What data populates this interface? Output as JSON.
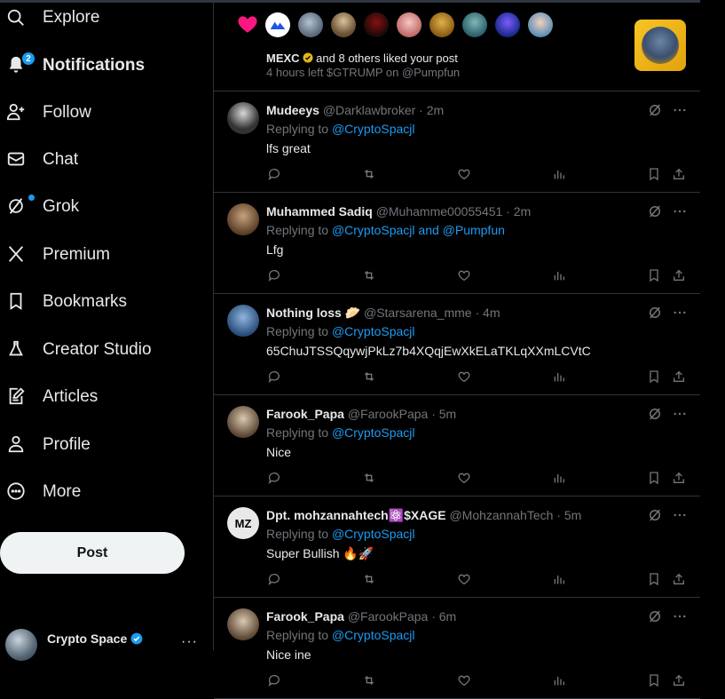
{
  "sidebar": {
    "items": [
      {
        "label": "Explore",
        "icon": "search-icon",
        "bold": false
      },
      {
        "label": "Notifications",
        "icon": "bell-icon",
        "bold": true,
        "badge": "2"
      },
      {
        "label": "Follow",
        "icon": "follow-icon",
        "bold": false
      },
      {
        "label": "Chat",
        "icon": "mail-icon",
        "bold": false
      },
      {
        "label": "Grok",
        "icon": "grok-icon",
        "bold": false
      },
      {
        "label": "Premium",
        "icon": "x-logo-icon",
        "bold": false
      },
      {
        "label": "Bookmarks",
        "icon": "bookmark-icon",
        "bold": false
      },
      {
        "label": "Creator Studio",
        "icon": "flask-icon",
        "bold": false
      },
      {
        "label": "Articles",
        "icon": "article-icon",
        "bold": false
      },
      {
        "label": "Profile",
        "icon": "person-icon",
        "bold": false
      },
      {
        "label": "More",
        "icon": "more-circle-icon",
        "bold": false
      }
    ],
    "post_label": "Post",
    "account": {
      "name": "Crypto Space",
      "more": "···"
    }
  },
  "like_notification": {
    "actor": "MEXC",
    "text": " and 8 others liked your post",
    "subtext": "4 hours left $GTRUMP  on @Pumpfun"
  },
  "replies": [
    {
      "name": "Mudeeys",
      "handle": "@Darklawbroker",
      "time": "2m",
      "replying_prefix": "Replying to ",
      "mentions": "@CryptoSpacjl",
      "body": "lfs great"
    },
    {
      "name": "Muhammed Sadiq",
      "handle": "@Muhamme00055451",
      "time": "2m",
      "replying_prefix": "Replying to ",
      "mentions": "@CryptoSpacjl and @Pumpfun",
      "body": "Lfg"
    },
    {
      "name": "Nothing loss 🥟",
      "handle": "@Starsarena_mme",
      "time": "4m",
      "replying_prefix": "Replying to ",
      "mentions": "@CryptoSpacjl",
      "body": "65ChuJTSSQqywjPkLz7b4XQqjEwXkELaTKLqXXmLCVtC"
    },
    {
      "name": "Farook_Papa",
      "handle": "@FarookPapa",
      "time": "5m",
      "replying_prefix": "Replying to ",
      "mentions": "@CryptoSpacjl",
      "body": "Nice"
    },
    {
      "name": "Dpt. mohzannahtech⚛️$XAGE",
      "handle": "@MohzannahTech",
      "time": "5m",
      "replying_prefix": "Replying to ",
      "mentions": "@CryptoSpacjl",
      "body": "Super Bullish 🔥🚀"
    },
    {
      "name": "Farook_Papa",
      "handle": "@FarookPapa",
      "time": "6m",
      "replying_prefix": "Replying to ",
      "mentions": "@CryptoSpacjl",
      "body": "Nice ine"
    }
  ],
  "avatar_initials": {
    "mohzannah": "MZ"
  },
  "colors": {
    "accent": "#1d9bf0",
    "heart": "#f91880",
    "border": "#2f3336",
    "muted": "#71767b"
  },
  "separator": " · "
}
